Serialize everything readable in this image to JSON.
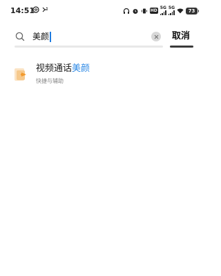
{
  "status_bar": {
    "time": "14:51",
    "left_icons": [
      "nfc-icon",
      "antenna-icon"
    ],
    "right_icons": [
      "headphones-icon",
      "alarm-icon",
      "vibrate-icon",
      "hd-icon",
      "signal-5g-icon",
      "signal-5g-icon",
      "wifi-icon"
    ],
    "hd_label": "HD",
    "signal_1_label": "5G",
    "signal_2_label": "5G",
    "battery": "73"
  },
  "search": {
    "query": "美颜",
    "cancel_label": "取消"
  },
  "results": [
    {
      "title_prefix": "视频通话",
      "title_highlight": "美颜",
      "subtitle": "快捷与辅助",
      "icon": "video-call-beauty-icon"
    }
  ],
  "colors": {
    "highlight": "#2f8ae5",
    "caret": "#1e7be0",
    "icon_orange": "#f39a2d",
    "icon_light": "#fbe3c4"
  }
}
